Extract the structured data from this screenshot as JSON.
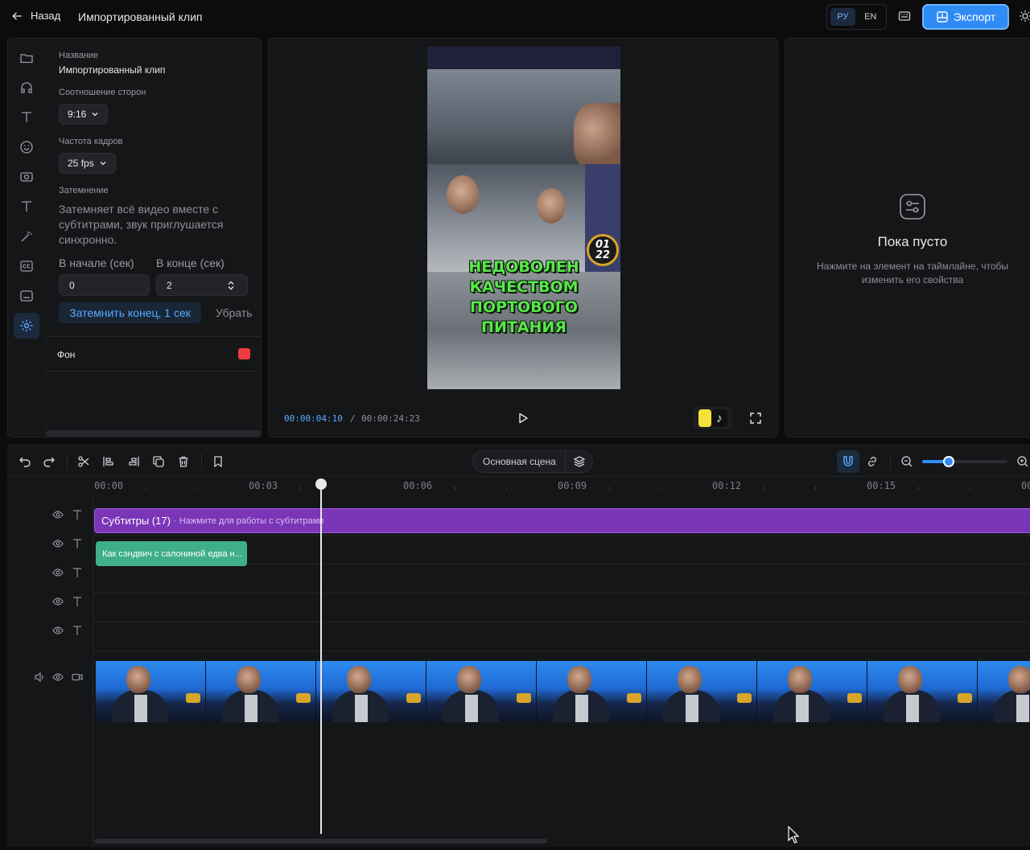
{
  "header": {
    "back_label": "Назад",
    "project_title": "Импортированный клип",
    "lang_ru": "РУ",
    "lang_en": "EN",
    "export_label": "Экспорт",
    "accent": "#2f8bf5"
  },
  "sidebar": {
    "icons": [
      "folder-icon",
      "headphones-icon",
      "text-icon",
      "smile-icon",
      "camera-icon",
      "text-icon",
      "magic-wand-icon",
      "cc-icon",
      "subtitles-icon",
      "gear-icon"
    ],
    "active": "gear-icon"
  },
  "properties": {
    "name_label": "Название",
    "name_value": "Импортированный клип",
    "aspect_label": "Соотношение сторон",
    "aspect_value": "9:16",
    "fps_label": "Частота кадров",
    "fps_value": "25 fps",
    "fade_label": "Затемнение",
    "fade_desc": "Затемняет всё видео вместе с субтитрами, звук приглушается синхронно.",
    "start_label": "В начале (сек)",
    "start_value": "0",
    "end_label": "В конце (сек)",
    "end_value": "2",
    "fade_button": "Затемнить конец, 1 сек",
    "remove_button": "Убрать",
    "bg_label": "Фон",
    "bg_color": "#ef3a3f"
  },
  "preview": {
    "caption_line1": "НЕДОВОЛЕН",
    "caption_line2": "КАЧЕСТВОМ",
    "caption_line3": "ПОРТОВОГО",
    "caption_line4": "ПИТАНИЯ",
    "badge_top": "01",
    "badge_bottom": "22",
    "current_time": "00:00:04:10",
    "time_sep": "/",
    "total_time": "00:00:24:23",
    "tiktok_glyph": "♪"
  },
  "inspector": {
    "empty_title": "Пока пусто",
    "empty_hint": "Нажмите на элемент на таймлайне, чтобы изменить его свойства"
  },
  "timeline": {
    "scene_label": "Основная сцена",
    "zoom_level": 0.31,
    "ruler": [
      "00:00",
      "00:03",
      "00:06",
      "00:09",
      "00:12",
      "00:15",
      "00"
    ],
    "subtitles_title": "Субтитры (17)",
    "subtitles_hint": "· Нажмите для работы с субтитрами",
    "clip_text": "Как сэндвич с салониной едва н...",
    "playhead_time": "00:04:10"
  }
}
